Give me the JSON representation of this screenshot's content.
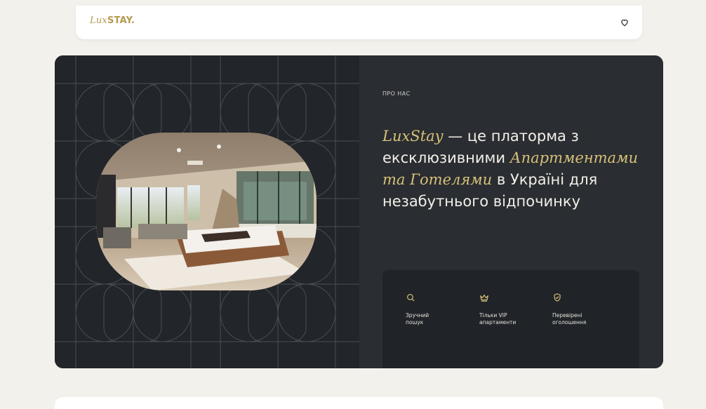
{
  "header": {
    "logo_italic": "Lux",
    "logo_bold": "STAY.",
    "favorite_icon": "heart-icon"
  },
  "hero": {
    "eyebrow": "ПРО НАС",
    "headline_brand": "LuxStay",
    "headline_part1": " — це платорма з ексклюзивними ",
    "headline_highlight": "Апартментами та Готелями",
    "headline_part2": " в Україні для незабутнього відпочинку",
    "features": [
      {
        "icon": "search-icon",
        "label": "Зручний\nпошук"
      },
      {
        "icon": "crown-icon",
        "label": "Тільки VIP\nапартаменти"
      },
      {
        "icon": "shield-check-icon",
        "label": "Перевірені\nоголошення"
      }
    ]
  },
  "colors": {
    "background": "#f3f1ec",
    "dark_panel": "#26292d",
    "gold_accent": "#d6c07a",
    "logo_gold": "#b39a4f"
  }
}
